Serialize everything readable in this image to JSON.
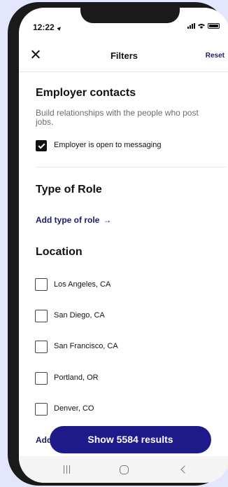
{
  "status_bar": {
    "time": "12:22"
  },
  "header": {
    "title": "Filters",
    "reset_label": "Reset"
  },
  "employer_contacts": {
    "title": "Employer contacts",
    "description": "Build relationships with the people who post jobs.",
    "option_label": "Employer is open to messaging",
    "option_checked": true
  },
  "type_of_role": {
    "title": "Type of Role",
    "add_label": "Add type of role",
    "arrow": "→"
  },
  "location": {
    "title": "Location",
    "options": [
      {
        "label": "Los Angeles, CA",
        "checked": false
      },
      {
        "label": "San Diego, CA",
        "checked": false
      },
      {
        "label": "San Francisco, CA",
        "checked": false
      },
      {
        "label": "Portland, OR",
        "checked": false
      },
      {
        "label": "Denver, CO",
        "checked": false
      }
    ],
    "add_label_partial": "Add"
  },
  "results_button": {
    "label": "Show 5584 results"
  },
  "colors": {
    "accent": "#1e1a8a",
    "link": "#1b1b6b",
    "background": "#e4e6fd"
  }
}
